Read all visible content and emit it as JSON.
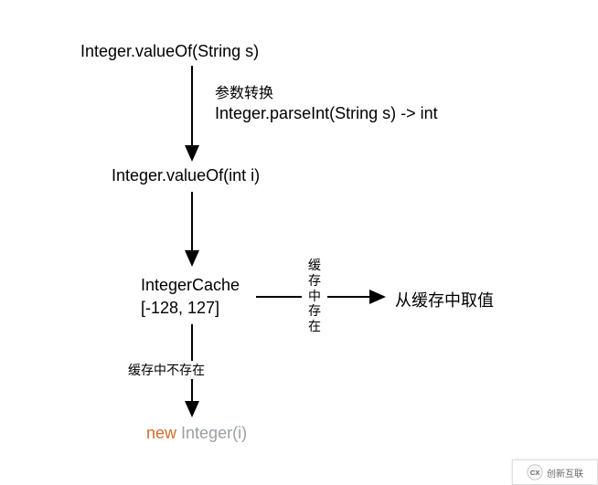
{
  "nodes": {
    "valueOfString": "Integer.valueOf(String s)",
    "parseInt": "Integer.parseInt(String s)  -> int",
    "valueOfInt": "Integer.valueOf(int i)",
    "cacheName": "IntegerCache",
    "cacheRange": "[-128, 127]",
    "newIntegerKw": "new",
    "newIntegerRest": " Integer(i)"
  },
  "labels": {
    "paramConvert": "参数转换",
    "inCache": "缓存中存在",
    "fromCache": "从缓存中取值",
    "notInCache": "缓存中不存在"
  },
  "watermark": {
    "logo": "CX",
    "text": "创新互联"
  }
}
